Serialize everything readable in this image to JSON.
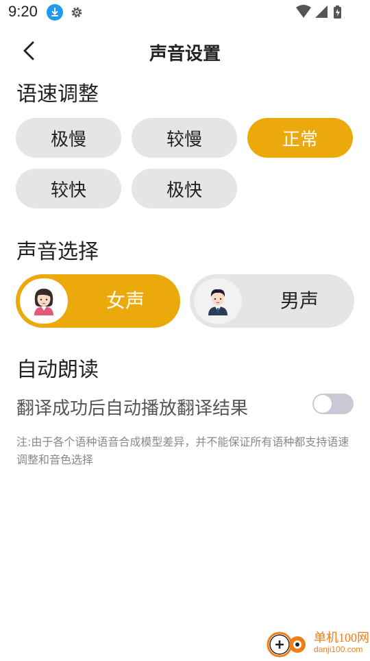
{
  "status_bar": {
    "time": "9:20",
    "icons": [
      "download-icon",
      "gear-icon",
      "wifi-icon",
      "signal-icon",
      "battery-icon"
    ]
  },
  "header": {
    "title": "声音设置",
    "back_icon": "chevron-left-icon"
  },
  "speed": {
    "title": "语速调整",
    "options": [
      "极慢",
      "较慢",
      "正常",
      "较快",
      "极快"
    ],
    "selected": "正常"
  },
  "voice": {
    "title": "声音选择",
    "options": [
      {
        "label": "女声",
        "icon": "female-avatar-icon"
      },
      {
        "label": "男声",
        "icon": "male-avatar-icon"
      }
    ],
    "selected": "女声"
  },
  "auto_read": {
    "title": "自动朗读",
    "toggle_label": "翻译成功后自动播放翻译结果",
    "enabled": false
  },
  "note": "注:由于各个语种语音合成模型差异，并不能保证所有语种都支持语速调整和音色选择",
  "watermark": {
    "text": "单机100网",
    "url": "danji100.com"
  },
  "colors": {
    "accent": "#eba90b",
    "pill_bg": "#e5e5e5",
    "toggle_off": "#c9c9d6"
  }
}
